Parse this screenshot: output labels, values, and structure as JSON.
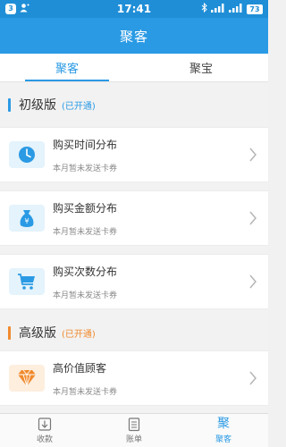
{
  "status_bar": {
    "notification_count": "3",
    "time": "17:41",
    "battery": "73"
  },
  "header": {
    "title": "聚客"
  },
  "tabs": [
    {
      "label": "聚客",
      "active": true
    },
    {
      "label": "聚宝",
      "active": false
    }
  ],
  "sections": [
    {
      "title": "初级版",
      "status": "(已开通)",
      "bar_color": "#2a9ae4",
      "status_color": "#2a9ae4",
      "items": [
        {
          "title": "购买时间分布",
          "subtitle": "本月暂未发送卡券",
          "icon": "clock-icon"
        },
        {
          "title": "购买金额分布",
          "subtitle": "本月暂未发送卡券",
          "icon": "money-bag-icon"
        },
        {
          "title": "购买次数分布",
          "subtitle": "本月暂未发送卡券",
          "icon": "cart-icon"
        }
      ]
    },
    {
      "title": "高级版",
      "status": "(已开通)",
      "bar_color": "#f08a2c",
      "status_color": "#f08a2c",
      "items": [
        {
          "title": "高价值顾客",
          "subtitle": "本月暂未发送卡券",
          "icon": "diamond-icon"
        }
      ]
    }
  ],
  "bottom_nav": [
    {
      "label": "收款",
      "icon": "collect-icon",
      "active": false
    },
    {
      "label": "账单",
      "icon": "bill-icon",
      "active": false
    },
    {
      "label": "聚客",
      "glyph": "聚",
      "icon": "juke-icon",
      "active": true
    }
  ],
  "colors": {
    "primary": "#2a9ae4",
    "status_bar": "#1f8ed7",
    "accent_orange": "#f08a2c"
  }
}
